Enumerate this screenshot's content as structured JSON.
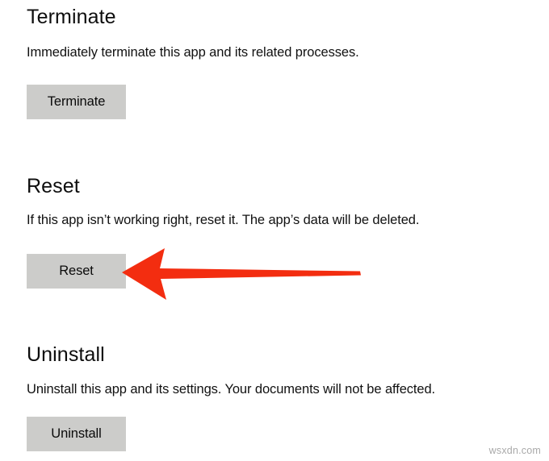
{
  "page": {
    "background_color": "#ffffff",
    "watermark": "wsxdn.com"
  },
  "sections": [
    {
      "id": "terminate",
      "heading": "Terminate",
      "description": "Immediately terminate this app and its related processes.",
      "button_label": "Terminate"
    },
    {
      "id": "reset",
      "heading": "Reset",
      "description": "If this app isn’t working right, reset it. The app’s data will be deleted.",
      "button_label": "Reset"
    },
    {
      "id": "uninstall",
      "heading": "Uninstall",
      "description": "Uninstall this app and its settings. Your documents will not be affected.",
      "button_label": "Uninstall"
    }
  ],
  "annotation": {
    "type": "arrow",
    "icon": "left-arrow-icon",
    "color": "#f32d10",
    "points_to": "reset-button",
    "direction": "left"
  },
  "colors": {
    "button_face": "#ccccca",
    "button_border": "#cdcdcb",
    "text": "#0d0d0d",
    "annotation_red": "#f32d10",
    "watermark_gray": "#a9a9a9"
  }
}
